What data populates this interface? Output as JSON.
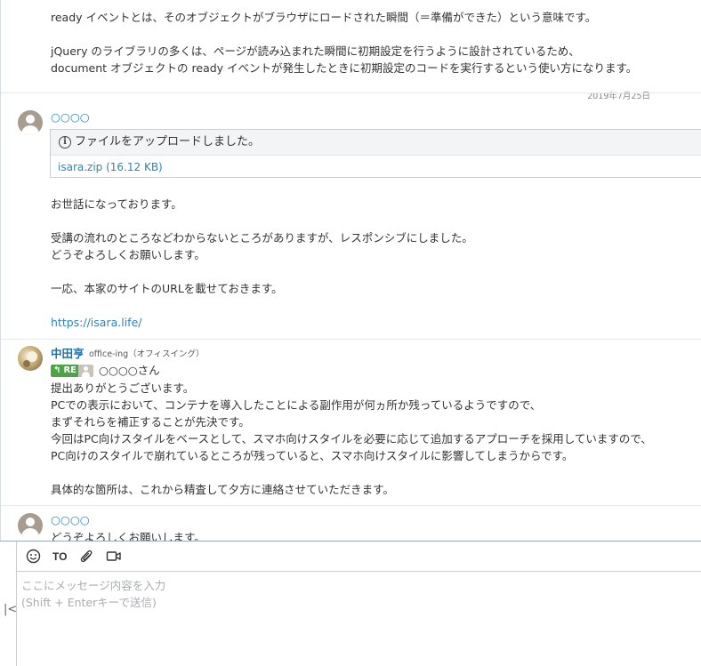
{
  "messages": [
    {
      "lines": [
        "ready イベントとは、そのオブジェクトがブラウザにロードされた瞬間（＝準備ができた）という意味です。",
        "",
        "jQuery のライブラリの多くは、ページが読み込まれた瞬間に初期設定を行うように設計されているため、",
        "document オブジェクトの ready イベントが発生したときに初期設定のコードを実行するという使い方になります。"
      ],
      "date": "2019年7月25日"
    },
    {
      "sender": "○○○○",
      "file_title": "ファイルをアップロードしました。",
      "file_link": "isara.zip (16.12 KB)",
      "lines": [
        "お世話になっております。",
        "",
        "受講の流れのところなどわからないところがありますが、レスポンシブにしました。",
        "どうぞよろしくお願いします。",
        "",
        "一応、本家のサイトのURLを載せておきます。",
        ""
      ],
      "link": "https://isara.life/"
    },
    {
      "sender": "中田亨",
      "sender_org": "office-ing（オフィスイング）",
      "re_label": "RE",
      "re_to": "○○○○さん",
      "lines": [
        "提出ありがとうございます。",
        "PCでの表示において、コンテナを導入したことによる副作用が何ヵ所か残っているようですので、",
        "まずそれらを補正することが先決です。",
        "今回はPC向けスタイルをベースとして、スマホ向けスタイルを必要に応じて追加するアプローチを採用していますので、",
        "PC向けのスタイルで崩れているところが残っていると、スマホ向けスタイルに影響してしまうからです。",
        "",
        "具体的な箇所は、これから精査して夕方に連絡させていただきます。"
      ]
    },
    {
      "sender": "○○○○",
      "lines": [
        "どうぞよろしくお願いします。"
      ]
    }
  ],
  "composer": {
    "to_label": "TO",
    "placeholder_line1": "ここにメッセージ内容を入力",
    "placeholder_line2": "(Shift + Enterキーで送信)",
    "collapse_glyph": "|<"
  },
  "icons": [
    "emoji-icon",
    "to-icon",
    "attach-icon",
    "video-icon",
    "info-icon",
    "collapse-icon"
  ]
}
